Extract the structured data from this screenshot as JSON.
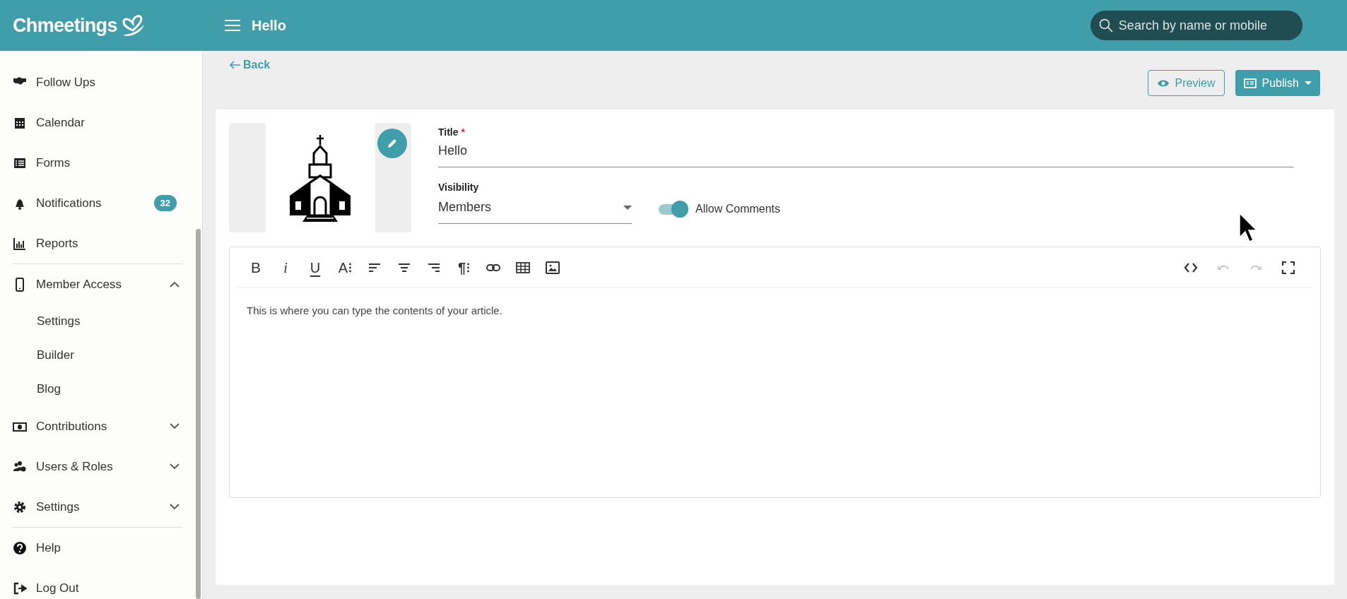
{
  "header": {
    "logo": "Chmeetings",
    "title": "Hello",
    "search": {
      "placeholder": "Search by name or mobile"
    }
  },
  "sidebar": {
    "items": [
      {
        "label": "Follow Ups"
      },
      {
        "label": "Calendar"
      },
      {
        "label": "Forms"
      },
      {
        "label": "Notifications",
        "badge": "32"
      },
      {
        "label": "Reports",
        "divider_after": true
      },
      {
        "label": "Member Access",
        "expanded": true,
        "children": [
          {
            "label": "Settings"
          },
          {
            "label": "Builder"
          },
          {
            "label": "Blog"
          }
        ]
      },
      {
        "label": "Contributions",
        "expanded": false
      },
      {
        "label": "Users & Roles",
        "expanded": false
      },
      {
        "label": "Settings",
        "expanded": false,
        "divider_after": true
      },
      {
        "label": "Help"
      },
      {
        "label": "Log Out"
      }
    ]
  },
  "back_link": "Back",
  "actions": {
    "preview": "Preview",
    "publish": "Publish"
  },
  "form": {
    "title": {
      "label": "Title",
      "required_mark": "*",
      "value": "Hello"
    },
    "visibility": {
      "label": "Visibility",
      "value": "Members"
    },
    "allow_comments": {
      "label": "Allow Comments",
      "on": true
    }
  },
  "editor": {
    "toolbar_left": [
      {
        "kind": "bold",
        "label": "B"
      },
      {
        "kind": "italic",
        "label": "i"
      },
      {
        "kind": "underline",
        "label": "U"
      },
      {
        "kind": "fontsize",
        "label": "A"
      },
      {
        "kind": "alignleft"
      },
      {
        "kind": "aligncenter"
      },
      {
        "kind": "alignright"
      },
      {
        "kind": "paragraph",
        "label": "¶"
      },
      {
        "kind": "link"
      },
      {
        "kind": "table"
      },
      {
        "kind": "image"
      }
    ],
    "toolbar_right": [
      {
        "kind": "code",
        "disabled": false
      },
      {
        "kind": "undo",
        "disabled": true
      },
      {
        "kind": "redo",
        "disabled": true
      },
      {
        "kind": "fullscreen",
        "disabled": false
      }
    ],
    "content": "This is where you can type the contents of your article."
  }
}
